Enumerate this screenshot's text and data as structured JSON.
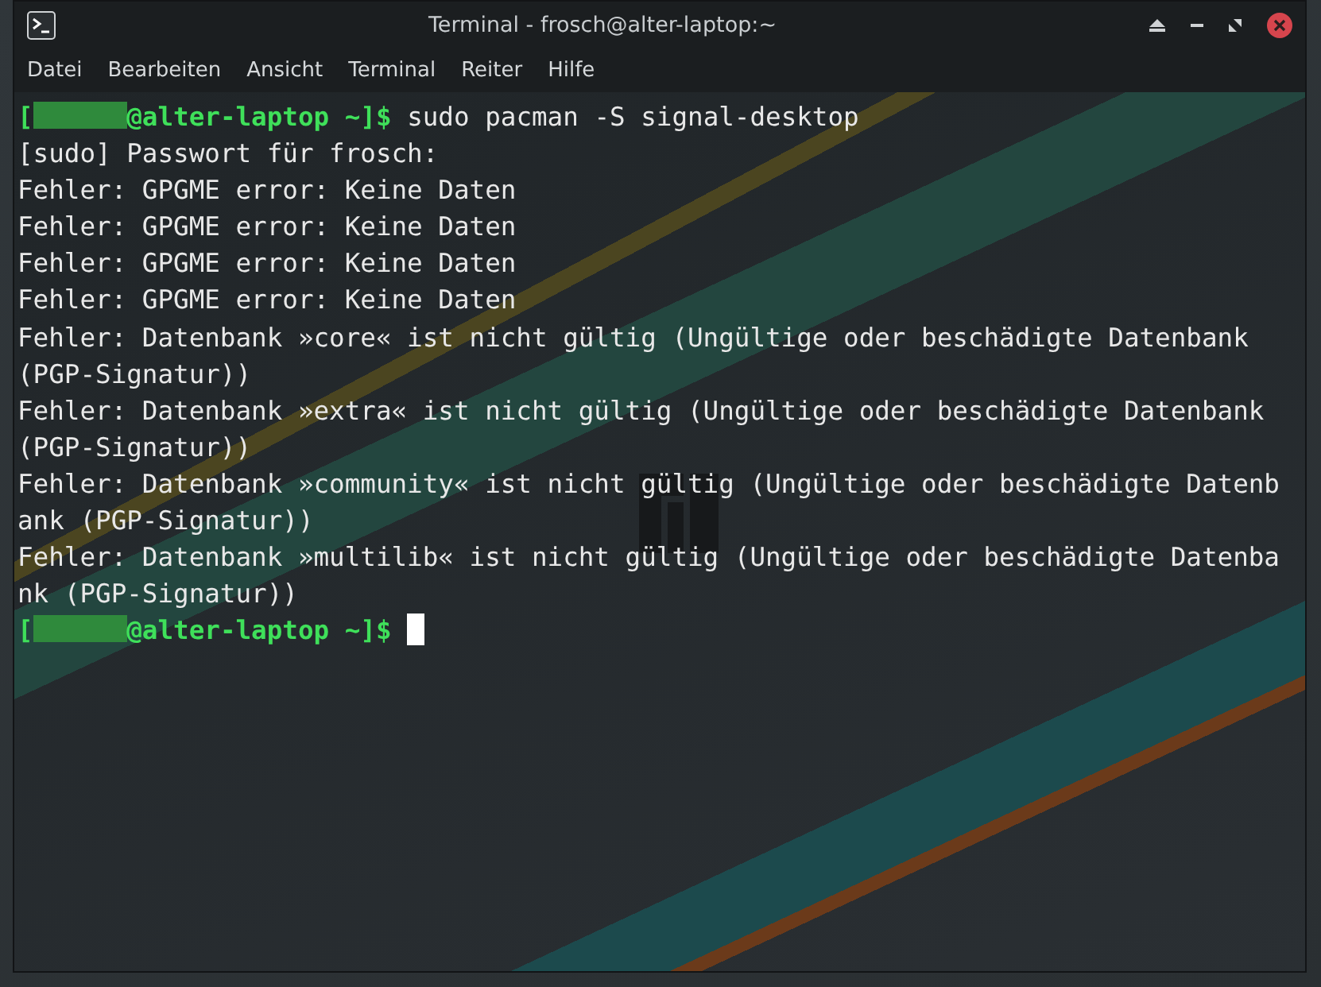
{
  "window": {
    "title": "Terminal - frosch@alter-laptop:~"
  },
  "menu": [
    "Datei",
    "Bearbeiten",
    "Ansicht",
    "Terminal",
    "Reiter",
    "Hilfe"
  ],
  "terminal": {
    "lines": [
      {
        "kind": "prompt",
        "open": "[",
        "host": "@alter-laptop ~]$",
        "command": "sudo pacman -S signal-desktop",
        "cursor": false
      },
      {
        "kind": "output",
        "text": "[sudo] Passwort für frosch:"
      },
      {
        "kind": "output",
        "text": "Fehler: GPGME error: Keine Daten"
      },
      {
        "kind": "output",
        "text": "Fehler: GPGME error: Keine Daten"
      },
      {
        "kind": "output",
        "text": "Fehler: GPGME error: Keine Daten"
      },
      {
        "kind": "output",
        "text": "Fehler: GPGME error: Keine Daten"
      },
      {
        "kind": "output",
        "text": "Fehler: Datenbank »core« ist nicht gültig (Ungültige oder beschädigte Datenbank (PGP-Signatur))"
      },
      {
        "kind": "output",
        "text": "Fehler: Datenbank »extra« ist nicht gültig (Ungültige oder beschädigte Datenbank (PGP-Signatur))"
      },
      {
        "kind": "output",
        "text": "Fehler: Datenbank »community« ist nicht gültig (Ungültige oder beschädigte Datenbank (PGP-Signatur))"
      },
      {
        "kind": "output",
        "text": "Fehler: Datenbank »multilib« ist nicht gültig (Ungültige oder beschädigte Datenbank (PGP-Signatur))"
      },
      {
        "kind": "prompt",
        "open": "[",
        "host": "@alter-laptop ~]$",
        "cursor": true
      }
    ]
  }
}
